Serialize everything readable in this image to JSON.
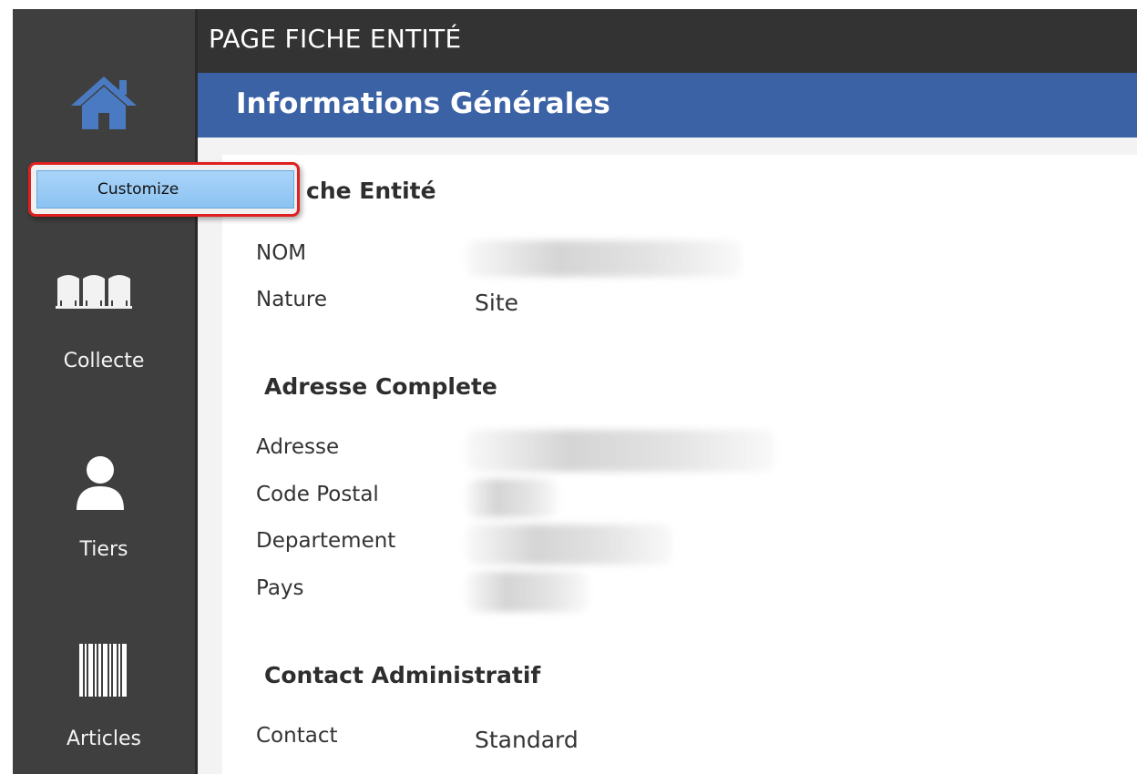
{
  "app": {
    "page_title": "PAGE FICHE ENTITÉ"
  },
  "sidebar": {
    "items": [
      {
        "icon": "home-icon",
        "label": ""
      },
      {
        "icon": "silos-icon",
        "label": "Collecte"
      },
      {
        "icon": "person-icon",
        "label": "Tiers"
      },
      {
        "icon": "barcode-icon",
        "label": "Articles"
      }
    ]
  },
  "context_menu": {
    "items": [
      {
        "label": "Customize"
      }
    ]
  },
  "section": {
    "title": "Informations Générales"
  },
  "groups": {
    "fiche": {
      "title": "Fiche Entité",
      "visible_title": "che Entité",
      "fields": [
        {
          "label": "NOM",
          "value": ""
        },
        {
          "label": "Nature",
          "value": "Site"
        }
      ]
    },
    "adresse": {
      "title": "Adresse Complete",
      "fields": [
        {
          "label": "Adresse",
          "value": ""
        },
        {
          "label": "Code Postal",
          "value": ""
        },
        {
          "label": "Departement",
          "value": ""
        },
        {
          "label": "Pays",
          "value": ""
        }
      ]
    },
    "contact": {
      "title": "Contact Administratif",
      "fields": [
        {
          "label": "Contact",
          "value": "Standard"
        }
      ]
    }
  },
  "colors": {
    "sidebar_bg": "#3f3f3f",
    "titlebar_bg": "#333333",
    "section_bar": "#3b62a5",
    "home_icon": "#4a7bc2",
    "menu_highlight": "#8cc3f2",
    "menu_outline": "#e02020"
  }
}
